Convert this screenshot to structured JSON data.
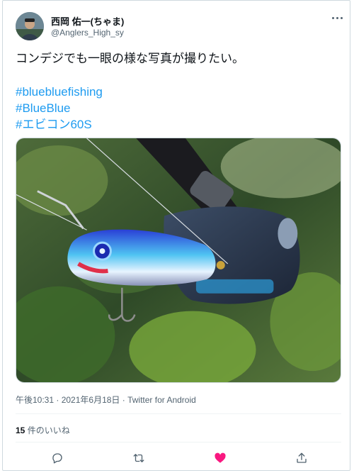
{
  "author": {
    "display_name": "西岡 佑一(ちゃま)",
    "handle": "@Anglers_High_sy"
  },
  "tweet": {
    "text": "コンデジでも一眼の様な写真が撮りたい。",
    "hashtags": [
      "#bluebluefishing",
      "#BlueBlue",
      "#エビコン60S"
    ]
  },
  "meta": {
    "timestamp": "午後10:31 · 2021年6月18日",
    "separator": " · ",
    "source": "Twitter for Android"
  },
  "likes": {
    "count": "15",
    "label": " 件のいいね"
  },
  "icons": {
    "more": "more-horizontal-icon",
    "reply": "reply-icon",
    "retweet": "retweet-icon",
    "like": "heart-filled-icon",
    "share": "share-icon"
  },
  "colors": {
    "hashtag": "#1d9bf0",
    "like_active": "#f91880",
    "secondary_text": "#536471"
  }
}
